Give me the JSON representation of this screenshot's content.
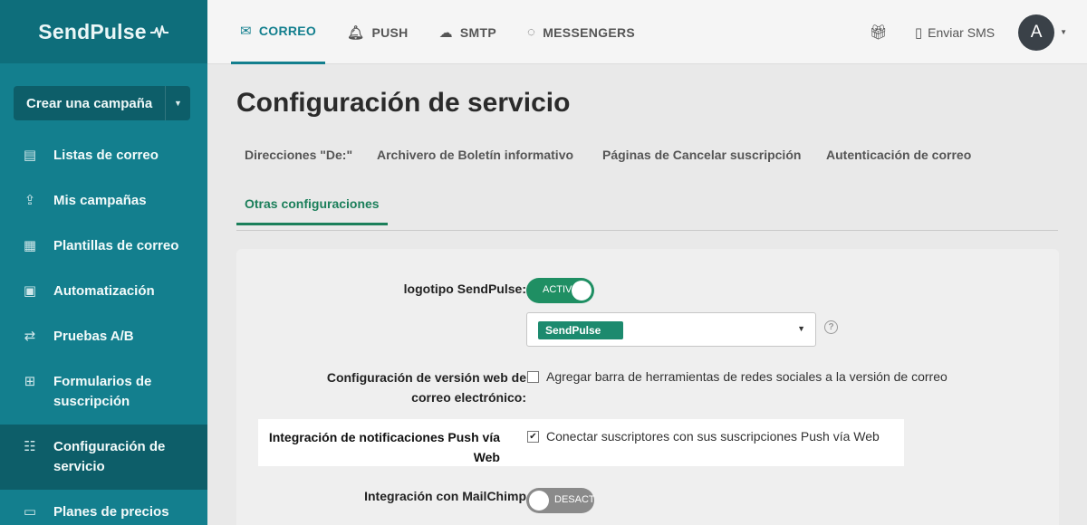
{
  "brand": {
    "name": "SendPulse"
  },
  "sidebar": {
    "create_button": "Crear una campaña",
    "items": [
      {
        "label": "Listas de correo",
        "icon": "list-icon"
      },
      {
        "label": "Mis campañas",
        "icon": "send-icon"
      },
      {
        "label": "Plantillas de correo",
        "icon": "template-icon"
      },
      {
        "label": "Automatización",
        "icon": "automation-icon"
      },
      {
        "label": "Pruebas A/B",
        "icon": "ab-test-icon"
      },
      {
        "label": "Formularios de suscripción",
        "icon": "form-icon"
      },
      {
        "label": "Configuración de servicio",
        "icon": "settings-icon",
        "active": true
      },
      {
        "label": "Planes de precios",
        "icon": "wallet-icon"
      }
    ]
  },
  "topbar": {
    "tabs": [
      {
        "label": "CORREO",
        "icon": "mail-icon",
        "active": true
      },
      {
        "label": "PUSH",
        "icon": "bell-icon"
      },
      {
        "label": "SMTP",
        "icon": "cloud-icon"
      },
      {
        "label": "MESSENGERS",
        "icon": "chat-icon"
      }
    ],
    "sms_label": "Enviar SMS",
    "avatar_initial": "A"
  },
  "page": {
    "title": "Configuración de servicio",
    "subtabs": [
      "Direcciones \"De:\"",
      "Archivero de Boletín informativo",
      "Páginas de Cancelar suscripción",
      "Autenticación de correo",
      "Otras configuraciones"
    ]
  },
  "settings": {
    "logo_label": "logotipo SendPulse:",
    "logo_toggle": "ACTIV",
    "logo_select_value": "SendPulse",
    "webversion_label": "Configuración de versión web de correo electrónico:",
    "webversion_option": "Agregar barra de herramientas de redes sociales a la versión de correo",
    "push_label": "Integración de notificaciones Push vía Web",
    "push_option": "Conectar suscriptores con sus suscripciones Push vía Web",
    "mailchimp_label": "Integración con MailChimp",
    "mailchimp_toggle": "DESACT"
  },
  "colors": {
    "accent": "#137f8e",
    "active_green": "#1f8f63",
    "dark": "#0d5e69"
  }
}
